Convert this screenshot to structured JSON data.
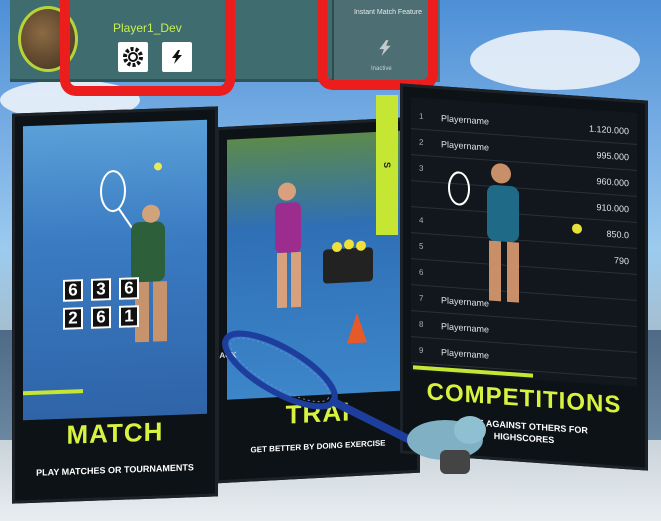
{
  "profile": {
    "player_name": "Player1_Dev",
    "settings_icon": "gear-icon",
    "mode_icon": "lightning-icon"
  },
  "instant_match": {
    "label": "Instant Match Feature",
    "status": "Inactive",
    "icon": "lightning-icon"
  },
  "cards": {
    "match": {
      "title": "MATCH",
      "subtitle": "PLAY MATCHES OR TOURNAMENTS",
      "scoreboard": {
        "row1": [
          "6",
          "3",
          "6"
        ],
        "row2": [
          "2",
          "6",
          "1"
        ]
      }
    },
    "training": {
      "title": "TRAI",
      "subtitle": "GET BETTER BY DOING EXERCISE",
      "court_text": "ACK"
    },
    "competitions": {
      "title": "COMPETITIONS",
      "subtitle_line1": "PETE AGAINST OTHERS FOR",
      "subtitle_line2": "HIGHSCORES",
      "side_banner": "S",
      "leaderboard": [
        {
          "rank": "1",
          "name": "Playername",
          "score": "1.120.000"
        },
        {
          "rank": "2",
          "name": "Playername",
          "score": "995.000"
        },
        {
          "rank": "3",
          "name": "",
          "score": "960.000"
        },
        {
          "rank": "",
          "name": "",
          "score": "910.000"
        },
        {
          "rank": "4",
          "name": "",
          "score": "850.0"
        },
        {
          "rank": "5",
          "name": "",
          "score": "790"
        },
        {
          "rank": "6",
          "name": "",
          "score": ""
        },
        {
          "rank": "7",
          "name": "Playername",
          "score": ""
        },
        {
          "rank": "8",
          "name": "Playername",
          "score": ""
        },
        {
          "rank": "9",
          "name": "Playername",
          "score": ""
        }
      ]
    }
  },
  "colors": {
    "accent": "#c5e632",
    "annotation": "#ec1d1d",
    "card_bg": "#0d1216"
  }
}
